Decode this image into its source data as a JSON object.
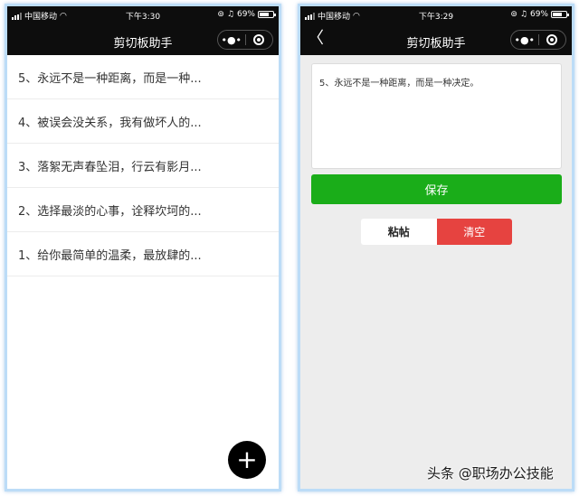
{
  "left_screen": {
    "status": {
      "carrier": "中国移动",
      "time": "下午3:30",
      "battery": "69%",
      "battery_level": 0.69
    },
    "nav": {
      "title": "剪切板助手",
      "more_glyph": "•●•"
    },
    "notes": [
      "5、永远不是一种距离，而是一种...",
      "4、被误会没关系，我有做坏人的...",
      "3、落絮无声春坠泪，行云有影月...",
      "2、选择最淡的心事，诠释坎坷的...",
      "1、给你最简单的温柔，最放肆的..."
    ],
    "fab_glyph": "+"
  },
  "right_screen": {
    "status": {
      "carrier": "中国移动",
      "time": "下午3:29",
      "battery": "69%",
      "battery_level": 0.69
    },
    "nav": {
      "title": "剪切板助手",
      "back_glyph": "〈",
      "more_glyph": "•●•"
    },
    "editor_text": "5、永远不是一种距离，而是一种决定。",
    "save_label": "保存",
    "paste_label": "粘帖",
    "clear_label": "清空"
  },
  "watermark": "头条 @职场办公技能",
  "colors": {
    "accent_green": "#1aad19",
    "danger_red": "#e64340",
    "nav_bg": "#0d0d0d"
  }
}
